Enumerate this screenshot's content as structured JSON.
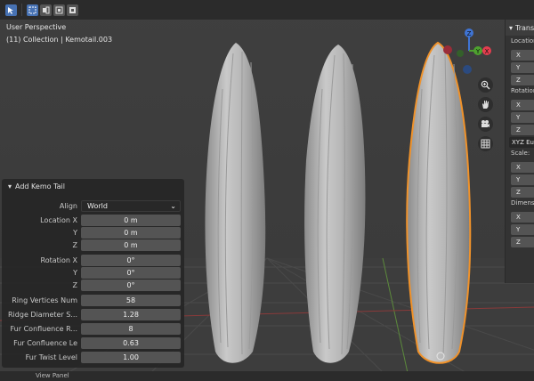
{
  "toolbar": {
    "icons": [
      "cursor-icon",
      "box-select-icon",
      "select-extend-icon",
      "select-subtract-icon",
      "select-invert-icon"
    ]
  },
  "viewport": {
    "title": "User Perspective",
    "subtitle": "(11) Collection | Kemotail.003"
  },
  "gizmo": {
    "z": "Z",
    "y": "Y",
    "x": "X",
    "colors": {
      "x": "#e33d4e",
      "y": "#4ea12f",
      "z": "#3f74d4"
    }
  },
  "nav_icons": [
    "zoom-icon",
    "hand-pan-icon",
    "camera-icon",
    "grid-icon"
  ],
  "n_panel": {
    "transform_title": "Transform",
    "location_label": "Location:",
    "rotation_label": "Rotation:",
    "scale_label": "Scale:",
    "dimensions_label": "Dimensions:",
    "axes": [
      "X",
      "Y",
      "Z"
    ],
    "rotation_mode": "XYZ Euler"
  },
  "operator_panel": {
    "title": "Add Kemo Tail",
    "align_label": "Align",
    "align_value": "World",
    "location_x_label": "Location X",
    "location_y_label": "Y",
    "location_z_label": "Z",
    "location_x": "0 m",
    "location_y": "0 m",
    "location_z": "0 m",
    "rotation_x_label": "Rotation X",
    "rotation_y_label": "Y",
    "rotation_z_label": "Z",
    "rotation_x": "0°",
    "rotation_y": "0°",
    "rotation_z": "0°",
    "ring_vertices_label": "Ring Vertices Num",
    "ring_vertices": "58",
    "ridge_diameter_label": "Ridge Diameter S...",
    "ridge_diameter": "1.28",
    "fur_confluence_r_label": "Fur Confluence R...",
    "fur_confluence_r": "8",
    "fur_confluence_le_label": "Fur Confluence Le",
    "fur_confluence_le": "0.63",
    "fur_twist_label": "Fur Twist Level",
    "fur_twist": "1.00"
  },
  "status": {
    "text": "View   Panel"
  },
  "colors": {
    "selection_outline": "#f0922a",
    "active_button": "#4772b3"
  }
}
